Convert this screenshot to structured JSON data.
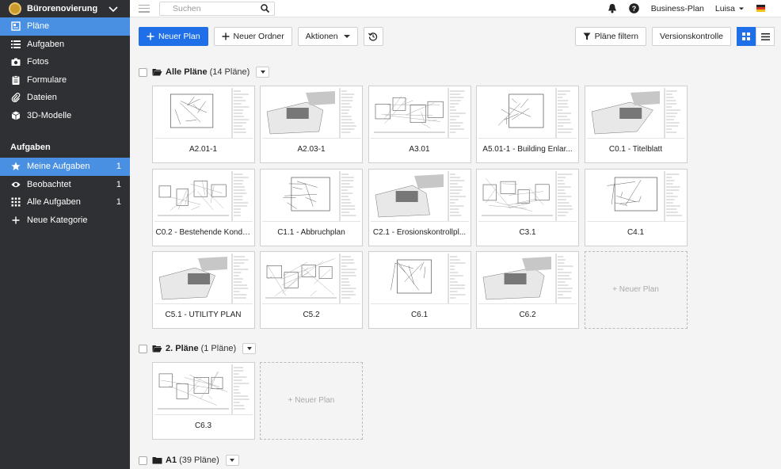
{
  "sidebar": {
    "project_name": "Bürorenovierung",
    "nav": [
      {
        "label": "Pläne",
        "icon": "plans-icon",
        "active": true
      },
      {
        "label": "Aufgaben",
        "icon": "list-icon"
      },
      {
        "label": "Fotos",
        "icon": "camera-icon"
      },
      {
        "label": "Formulare",
        "icon": "clipboard-icon"
      },
      {
        "label": "Dateien",
        "icon": "paperclip-icon"
      },
      {
        "label": "3D-Modelle",
        "icon": "cube-icon"
      }
    ],
    "tasks_title": "Aufgaben",
    "tasks": [
      {
        "label": "Meine Aufgaben",
        "count": "1",
        "icon": "star-icon",
        "active": true
      },
      {
        "label": "Beobachtet",
        "count": "1",
        "icon": "eye-icon"
      },
      {
        "label": "Alle Aufgaben",
        "count": "1",
        "icon": "grid-icon"
      },
      {
        "label": "Neue Kategorie",
        "count": "",
        "icon": "plus-icon"
      }
    ]
  },
  "topbar": {
    "search_placeholder": "Suchen",
    "plan_label": "Business-Plan",
    "user_name": "Luisa"
  },
  "toolbar": {
    "new_plan": "Neuer Plan",
    "new_folder": "Neuer Ordner",
    "actions": "Aktionen",
    "filter": "Pläne filtern",
    "version_control": "Versionskontrolle"
  },
  "groups": [
    {
      "name": "Alle Pläne",
      "count": "(14 Pläne)",
      "plans": [
        "A2.01-1",
        "A2.03-1",
        "A3.01",
        "A5.01-1 - Building Enlar...",
        "C0.1 - Titelblatt",
        "C0.2 - Bestehende Kondi...",
        "C1.1 - Abbruchplan",
        "C2.1 - Erosionskontrollpl...",
        "C3.1",
        "C4.1",
        "C5.1 - UTILITY PLAN",
        "C5.2",
        "C6.1",
        "C6.2"
      ],
      "new_label": "+ Neuer Plan"
    },
    {
      "name": "2. Pläne",
      "count": "(1 Pläne)",
      "plans": [
        "C6.3"
      ],
      "new_label": "+ Neuer Plan"
    },
    {
      "name": "A1",
      "count": "(39 Pläne)",
      "plans": [],
      "new_label": ""
    }
  ],
  "colors": {
    "accent": "#1f6fe8",
    "sidebar_bg": "#2e3033",
    "sidebar_active": "#4a90e2"
  }
}
